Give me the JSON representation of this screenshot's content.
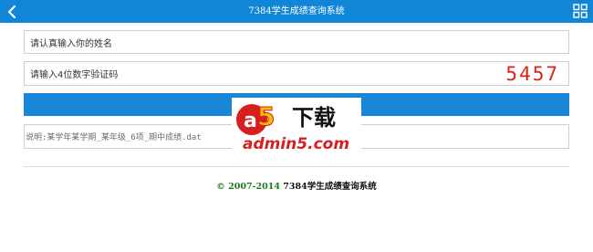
{
  "header": {
    "title": "7384学生成绩查询系统",
    "back_icon": "chevron-left-icon",
    "menu_icon": "grid-icon"
  },
  "form": {
    "name_placeholder": "请认真输入你的姓名",
    "code_placeholder": "请输入4位数字验证码",
    "captcha": "5457",
    "submit_label": "",
    "note": "说明:某学年某学期_某年级_6项_期中成绩.dat"
  },
  "footer": {
    "copyright_symbol": "©",
    "years": "2007-2014",
    "system_name": "7384学生成绩查询系统"
  },
  "watermark": {
    "logo_text": "a5",
    "label": "下载",
    "url": "admin5.com"
  },
  "colors": {
    "header_bg": "#1186d9",
    "submit_bg": "#1a86d8",
    "captcha": "#e0201a",
    "footer_green": "#1a7a1a"
  }
}
